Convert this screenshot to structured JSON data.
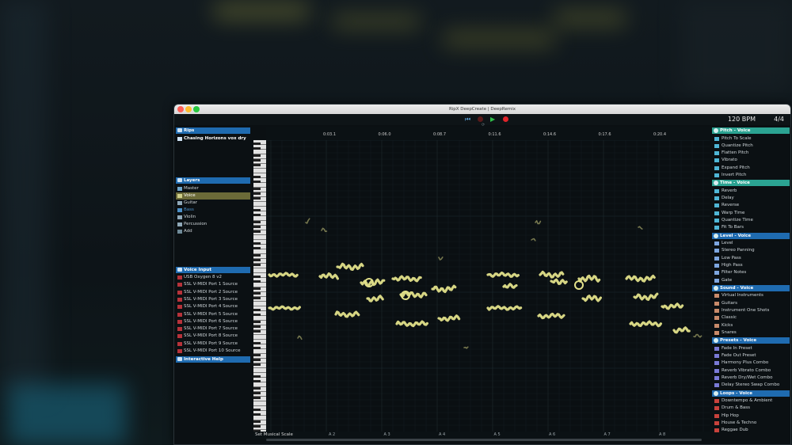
{
  "window": {
    "title": "RipX DeepCreate | DeepRemix"
  },
  "transport": {
    "bpm": "120 BPM",
    "time_signature": "4/4",
    "icons": [
      "skip-back-icon",
      "record-arm-icon",
      "play-icon",
      "record-icon",
      "loop-icon"
    ]
  },
  "rips": {
    "header": "Rips",
    "file": "Chasing Horizons vox dry"
  },
  "layers": {
    "header": "Layers",
    "items": [
      {
        "label": "Master"
      },
      {
        "label": "Voice"
      },
      {
        "label": "Guitar"
      },
      {
        "label": "Bass"
      },
      {
        "label": "Violin"
      },
      {
        "label": "Percussion"
      },
      {
        "label": "Add"
      }
    ]
  },
  "voice_input": {
    "header": "Voice Input",
    "items": [
      {
        "label": "USB Oxygen 8 v2"
      },
      {
        "label": "SSL V-MIDI Port 1 Source"
      },
      {
        "label": "SSL V-MIDI Port 2 Source"
      },
      {
        "label": "SSL V-MIDI Port 3 Source"
      },
      {
        "label": "SSL V-MIDI Port 4 Source"
      },
      {
        "label": "SSL V-MIDI Port 5 Source"
      },
      {
        "label": "SSL V-MIDI Port 6 Source"
      },
      {
        "label": "SSL V-MIDI Port 7 Source"
      },
      {
        "label": "SSL V-MIDI Port 8 Source"
      },
      {
        "label": "SSL V-MIDI Port 9 Source"
      },
      {
        "label": "SSL V-MIDI Port 10 Source"
      }
    ]
  },
  "interactive_help": {
    "header": "Interactive Help"
  },
  "timeline": {
    "ticks": [
      "0:03.1",
      "0:06.0",
      "0:08.7",
      "0:11.6",
      "0:14.6",
      "0:17.6",
      "0:20.4"
    ]
  },
  "bottom": {
    "scale_button": "Set Musical Scale",
    "labels": [
      "A 2",
      "A 3",
      "A 4",
      "A 5",
      "A 6",
      "A 7",
      "A 8"
    ]
  },
  "right_panel": {
    "sections": [
      {
        "header": "Pitch - Voice",
        "style": "teal",
        "items": [
          "Pitch To Scale",
          "Quantize Pitch",
          "Flatten Pitch",
          "Vibrato",
          "Expand Pitch",
          "Invert Pitch"
        ]
      },
      {
        "header": "Time - Voice",
        "style": "teal",
        "items": [
          "Reverb",
          "Delay",
          "Reverse",
          "Warp Time",
          "Quantize Time",
          "Fit To Bars"
        ]
      },
      {
        "header": "Level - Voice",
        "style": "blue",
        "items": [
          "Level",
          "Stereo Panning",
          "Low Pass",
          "High Pass",
          "Filter Notes",
          "Gate"
        ]
      },
      {
        "header": "Sound - Voice",
        "style": "blue",
        "items": [
          "Virtual Instruments",
          "Guitars",
          "Instrument One Shots",
          "Classic",
          "Kicks",
          "Snares"
        ]
      },
      {
        "header": "Presets - Voice",
        "style": "blue",
        "items": [
          "Fade In Preset",
          "Fade Out Preset",
          "Harmony Plus Combo",
          "Reverb Vibrato Combo",
          "Reverb Dry/Wet Combo",
          "Delay Stereo Swap Combo"
        ]
      },
      {
        "header": "Loops - Voice",
        "style": "blue",
        "items": [
          "Downtempo & Ambient",
          "Drum & Bass",
          "Hip Hop",
          "House & Techno",
          "Reggae Dub"
        ]
      }
    ]
  },
  "colors": {
    "accent_blue": "#1f6bb0",
    "accent_teal": "#2ba392",
    "note_color": "#e2e08a",
    "selected_layer": "#6b6a38"
  }
}
